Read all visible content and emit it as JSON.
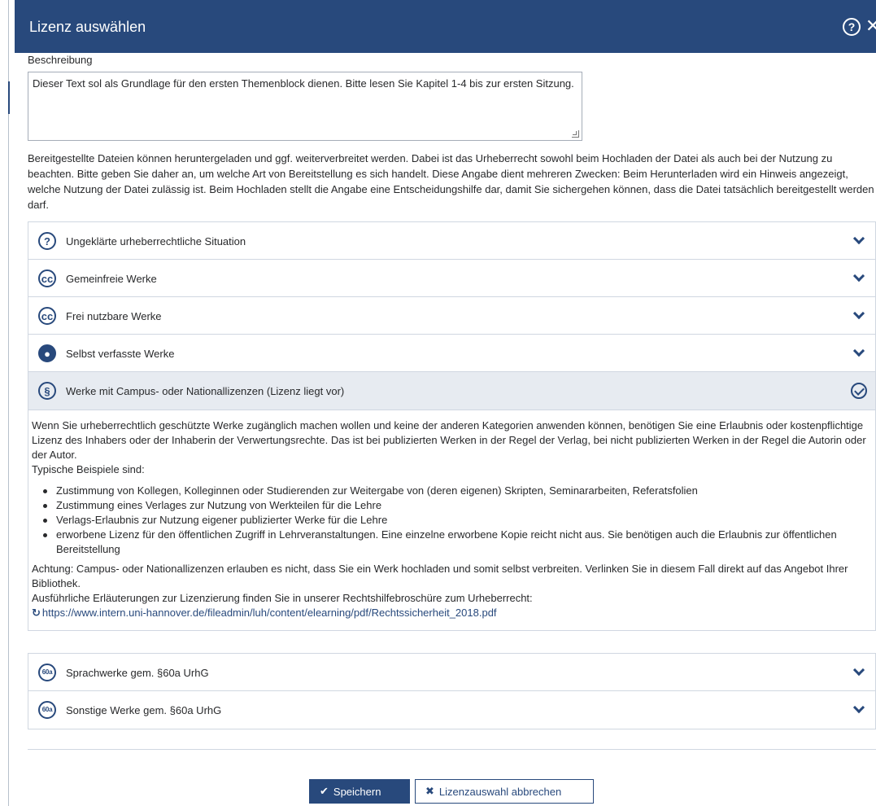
{
  "dialog": {
    "title": "Lizenz auswählen",
    "help_icon": "question-circle-icon",
    "close_icon": "close-icon",
    "help_glyph": "?",
    "close_glyph": "✕"
  },
  "description": {
    "label": "Beschreibung",
    "value": "Dieser Text sol als Grundlage für den ersten Themenblock dienen. Bitte lesen Sie Kapitel 1-4 bis zur ersten Sitzung."
  },
  "intro_text": "Bereitgestellte Dateien können heruntergeladen und ggf. weiterverbreitet werden. Dabei ist das Urheberrecht sowohl beim Hochladen der Datei als auch bei der Nutzung zu beachten. Bitte geben Sie daher an, um welche Art von Bereitstellung es sich handelt. Diese Angabe dient mehreren Zwecken: Beim Herunterladen wird ein Hinweis angezeigt, welche Nutzung der Datei zulässig ist. Beim Hochladen stellt die Angabe eine Entscheidungshilfe dar, damit Sie sichergehen können, dass die Datei tatsächlich bereitgestellt werden darf.",
  "licenses": [
    {
      "label": "Ungeklärte urheberrechtliche Situation",
      "icon": "question-circle-icon",
      "glyph": "?",
      "state": "collapsed"
    },
    {
      "label": "Gemeinfreie Werke",
      "icon": "creative-commons-icon",
      "glyph": "cc",
      "state": "collapsed"
    },
    {
      "label": "Frei nutzbare Werke",
      "icon": "creative-commons-icon",
      "glyph": "cc",
      "state": "collapsed"
    },
    {
      "label": "Selbst verfasste Werke",
      "icon": "user-circle-icon",
      "glyph": "●",
      "state": "collapsed"
    },
    {
      "label": "Werke mit Campus- oder Nationallizenzen (Lizenz liegt vor)",
      "icon": "paragraph-icon",
      "glyph": "§",
      "state": "selected"
    },
    {
      "label": "Sprachwerke gem. §60a UrhG",
      "icon": "60a-icon",
      "glyph": "60a",
      "state": "collapsed"
    },
    {
      "label": "Sonstige Werke gem. §60a UrhG",
      "icon": "60a-icon",
      "glyph": "60a",
      "state": "collapsed"
    }
  ],
  "selected_detail": {
    "paragraph1": "Wenn Sie urheberrechtlich geschützte Werke zugänglich machen wollen und keine der anderen Kategorien anwenden können, benötigen Sie eine Erlaubnis oder kostenpflichtige Lizenz des Inhabers oder der Inhaberin der Verwertungsrechte. Das ist bei publizierten Werken in der Regel der Verlag, bei nicht publizierten Werken in der Regel die Autorin oder der Autor.",
    "examples_heading": "Typische Beispiele sind:",
    "examples": [
      "Zustimmung von Kollegen, Kolleginnen oder Studierenden zur Weitergabe von (deren eigenen) Skripten, Seminararbeiten, Referatsfolien",
      "Zustimmung eines Verlages zur Nutzung von Werkteilen für die Lehre",
      "Verlags-Erlaubnis zur Nutzung eigener publizierter Werke für die Lehre",
      "erworbene Lizenz für den öffentlichen Zugriff in Lehrveranstaltungen. Eine einzelne erworbene Kopie reicht nicht aus. Sie benötigen auch die Erlaubnis zur öffentlichen Bereitstellung"
    ],
    "warning": "Achtung: Campus- oder Nationallizenzen erlauben es nicht, dass Sie ein Werk hochladen und somit selbst verbreiten. Verlinken Sie in diesem Fall direkt auf das Angebot Ihrer Bibliothek.",
    "more_info": "Ausführliche Erläuterungen zur Lizenzierung finden Sie in unserer Rechtshilfebroschüre zum Urheberrecht:",
    "link_icon": "external-link-icon",
    "link_glyph": "↻",
    "link": "https://www.intern.uni-hannover.de/fileadmin/luh/content/elearning/pdf/Rechtssicherheit_2018.pdf"
  },
  "buttons": {
    "save_label": "Speichern",
    "save_icon": "check-icon",
    "save_glyph": "✔",
    "cancel_label": "Lizenzauswahl abbrechen",
    "cancel_icon": "x-icon",
    "cancel_glyph": "✖"
  },
  "colors": {
    "primary": "#28497c",
    "active_row": "#e7ebf1",
    "border": "#d0d7e1"
  }
}
